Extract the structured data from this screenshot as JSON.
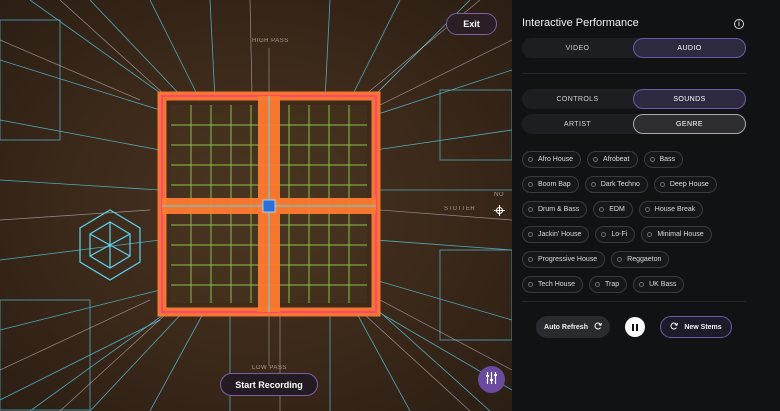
{
  "stage": {
    "exit_label": "Exit",
    "record_label": "Start Recording",
    "axis_top": "HIGH PASS",
    "axis_bottom": "LOW PASS",
    "axis_right_top": "NO",
    "axis_right_bottom": "STUTTER",
    "colors": {
      "grid_orange": "#ff7a2e",
      "grid_green": "#8fd14f",
      "wire_cyan": "#5ad4f2",
      "accent_purple": "#6a4a9e"
    }
  },
  "panel": {
    "title": "Interactive Performance",
    "mode_tabs": [
      {
        "label": "VIDEO",
        "active": false
      },
      {
        "label": "AUDIO",
        "active": true
      }
    ],
    "section_tabs": [
      {
        "label": "CONTROLS",
        "active": false
      },
      {
        "label": "SOUNDS",
        "active": true
      }
    ],
    "filter_tabs": [
      {
        "label": "ARTIST",
        "active": false
      },
      {
        "label": "GENRE",
        "active": true
      }
    ],
    "genres": [
      [
        "Afro House",
        "Afrobeat",
        "Bass"
      ],
      [
        "Boom Bap",
        "Dark Techno",
        "Deep House"
      ],
      [
        "Drum & Bass",
        "EDM",
        "House Break"
      ],
      [
        "Jackin' House",
        "Lo-Fi",
        "Minimal House"
      ],
      [
        "Progressive House",
        "Reggaeton"
      ],
      [
        "Tech House",
        "Trap",
        "UK Bass"
      ]
    ],
    "auto_refresh_label": "Auto Refresh",
    "new_stems_label": "New Stems"
  }
}
